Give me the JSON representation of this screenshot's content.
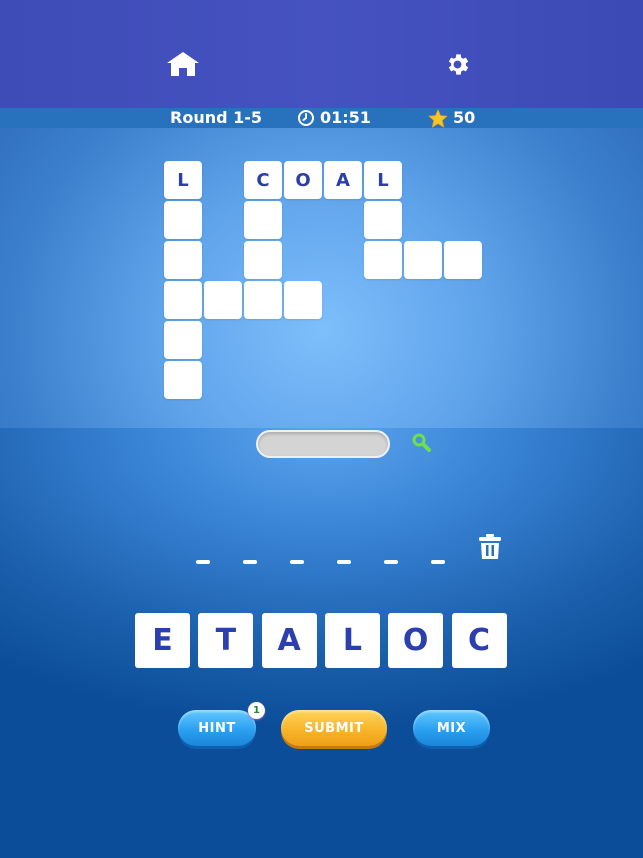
{
  "header": {
    "home_icon": "home-icon",
    "settings_icon": "gear-icon"
  },
  "status": {
    "round": "Round 1-5",
    "timer": "01:51",
    "stars": "50"
  },
  "board": {
    "cells": [
      {
        "row": 0,
        "col": 0,
        "letter": "L"
      },
      {
        "row": 0,
        "col": 2,
        "letter": "C"
      },
      {
        "row": 0,
        "col": 3,
        "letter": "O"
      },
      {
        "row": 0,
        "col": 4,
        "letter": "A"
      },
      {
        "row": 0,
        "col": 5,
        "letter": "L"
      },
      {
        "row": 1,
        "col": 0,
        "letter": ""
      },
      {
        "row": 1,
        "col": 2,
        "letter": ""
      },
      {
        "row": 1,
        "col": 5,
        "letter": ""
      },
      {
        "row": 2,
        "col": 0,
        "letter": ""
      },
      {
        "row": 2,
        "col": 2,
        "letter": ""
      },
      {
        "row": 2,
        "col": 5,
        "letter": ""
      },
      {
        "row": 2,
        "col": 6,
        "letter": ""
      },
      {
        "row": 2,
        "col": 7,
        "letter": ""
      },
      {
        "row": 3,
        "col": 0,
        "letter": ""
      },
      {
        "row": 3,
        "col": 1,
        "letter": ""
      },
      {
        "row": 3,
        "col": 2,
        "letter": ""
      },
      {
        "row": 3,
        "col": 3,
        "letter": ""
      },
      {
        "row": 4,
        "col": 0,
        "letter": ""
      },
      {
        "row": 5,
        "col": 0,
        "letter": ""
      }
    ]
  },
  "answer": {
    "slots": [
      "",
      "",
      "",
      "",
      "",
      ""
    ]
  },
  "letters": [
    "E",
    "T",
    "A",
    "L",
    "O",
    "C"
  ],
  "buttons": {
    "hint": "HINT",
    "hint_count": "1",
    "submit": "SUBMIT",
    "mix": "MIX"
  },
  "colors": {
    "letter": "#2c3fae",
    "search_icon": "#6ee04a",
    "star": "#f7c52a"
  }
}
